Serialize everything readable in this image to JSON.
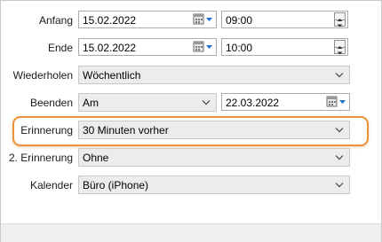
{
  "form": {
    "anfang": {
      "label": "Anfang",
      "date": "15.02.2022",
      "time": "09:00"
    },
    "ende": {
      "label": "Ende",
      "date": "15.02.2022",
      "time": "10:00"
    },
    "wiederholen": {
      "label": "Wiederholen",
      "value": "Wöchentlich"
    },
    "beenden": {
      "label": "Beenden",
      "mode": "Am",
      "date": "22.03.2022"
    },
    "erinnerung": {
      "label": "Erinnerung",
      "value": "30 Minuten vorher"
    },
    "erinnerung2": {
      "label": "2. Erinnerung",
      "value": "Ohne"
    },
    "kalender": {
      "label": "Kalender",
      "value": "Büro (iPhone)"
    }
  },
  "colors": {
    "highlight": "#e9913b",
    "accent": "#1a6fd6"
  },
  "icons": {
    "calendar": "calendar-icon",
    "dropdown": "chevron-down-icon",
    "spinner": "spinner-arrows-icon"
  }
}
